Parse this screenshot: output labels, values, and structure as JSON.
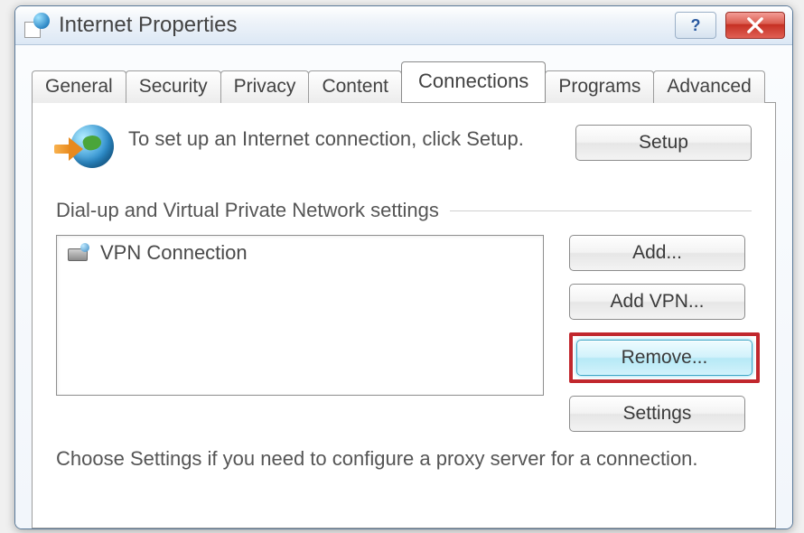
{
  "window": {
    "title": "Internet Properties"
  },
  "tabs": {
    "items": [
      {
        "label": "General"
      },
      {
        "label": "Security"
      },
      {
        "label": "Privacy"
      },
      {
        "label": "Content"
      },
      {
        "label": "Connections"
      },
      {
        "label": "Programs"
      },
      {
        "label": "Advanced"
      }
    ],
    "active_index": 4
  },
  "setup": {
    "text": "To set up an Internet connection, click Setup.",
    "button": "Setup"
  },
  "dialup_group": {
    "label": "Dial-up and Virtual Private Network settings",
    "connections": [
      {
        "name": "VPN Connection"
      }
    ],
    "buttons": {
      "add": "Add...",
      "add_vpn": "Add VPN...",
      "remove": "Remove...",
      "settings": "Settings"
    },
    "settings_hint": "Choose Settings if you need to configure a proxy server for a connection."
  }
}
